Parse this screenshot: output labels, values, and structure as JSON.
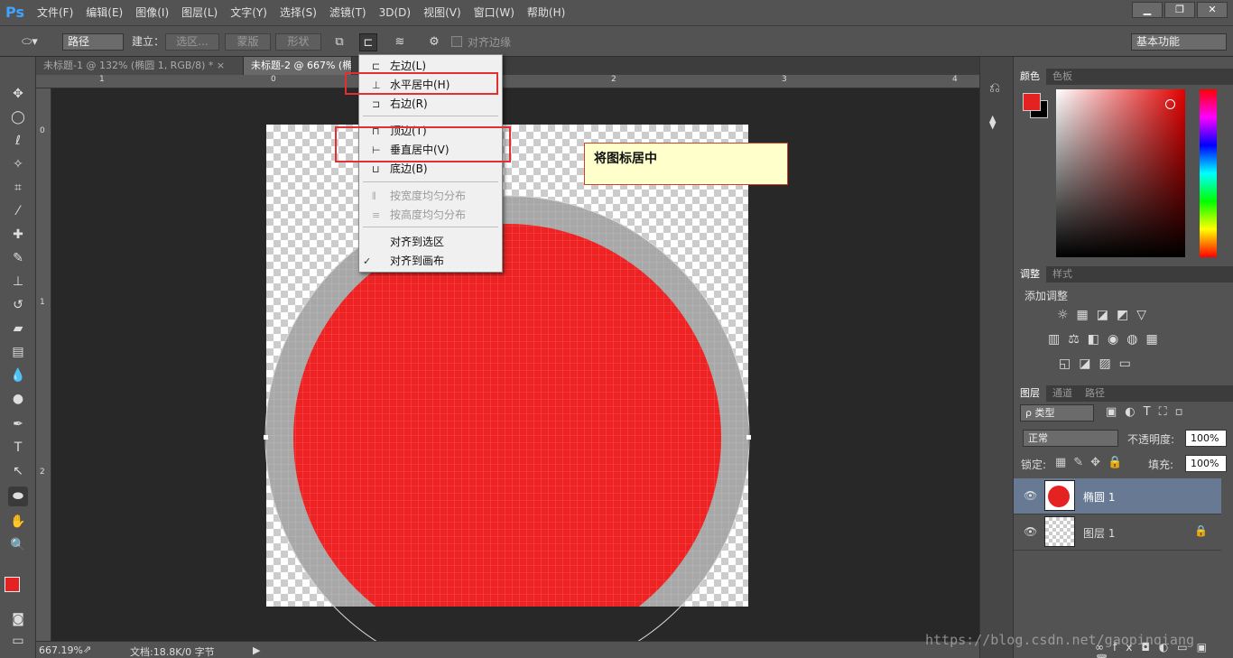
{
  "app": {
    "logo": "Ps"
  },
  "menubar": {
    "items": [
      "文件(F)",
      "编辑(E)",
      "图像(I)",
      "图层(L)",
      "文字(Y)",
      "选择(S)",
      "滤镜(T)",
      "3D(D)",
      "视图(V)",
      "窗口(W)",
      "帮助(H)"
    ]
  },
  "window_controls": {
    "minimize": "▁",
    "restore": "❐",
    "close": "✕"
  },
  "options": {
    "mode_select": "路径",
    "make_label": "建立：",
    "selection_btn": "选区...",
    "mask_btn": "蒙版",
    "shape_btn": "形状",
    "align_edges_label": "对齐边缘",
    "workspace_select": "基本功能"
  },
  "tabs": [
    {
      "label": "未标题-1 @ 132% (椭圆 1, RGB/8) *",
      "close": "×"
    },
    {
      "label": "未标题-2 @ 667% (椭",
      "close": ""
    }
  ],
  "ruler": {
    "h": [
      "1",
      "0",
      "1",
      "2",
      "3",
      "4"
    ],
    "v": [
      "0",
      "1",
      "2"
    ]
  },
  "align_menu": {
    "items": [
      {
        "label": "左边(L)",
        "disabled": false
      },
      {
        "label": "水平居中(H)",
        "disabled": false
      },
      {
        "label": "右边(R)",
        "disabled": false
      },
      {
        "label": "顶边(T)",
        "disabled": false
      },
      {
        "label": "垂直居中(V)",
        "disabled": false
      },
      {
        "label": "底边(B)",
        "disabled": false
      },
      {
        "label": "按宽度均匀分布",
        "disabled": true
      },
      {
        "label": "按高度均匀分布",
        "disabled": true
      },
      {
        "label": "对齐到选区",
        "disabled": false
      },
      {
        "label": "对齐到画布",
        "disabled": false,
        "checked": true
      }
    ],
    "checkmark": "✓"
  },
  "annotation": {
    "text": "将图标居中"
  },
  "statusbar": {
    "zoom": "667.19%",
    "doc_info": "文档:18.8K/0 字节"
  },
  "watermark": "https://blog.csdn.net/gaopinqiang",
  "color_panel": {
    "tabs": [
      "颜色",
      "色板"
    ],
    "foreground": "#e52222",
    "background": "#000000"
  },
  "adjust_panel": {
    "tabs": [
      "调整",
      "样式"
    ],
    "title": "添加调整"
  },
  "layers_panel": {
    "tabs": [
      "图层",
      "通道",
      "路径"
    ],
    "filter": "ρ 类型",
    "blend_mode": "正常",
    "opacity_label": "不透明度:",
    "opacity": "100%",
    "lock_label": "锁定:",
    "fill_label": "填充:",
    "fill": "100%",
    "layers": [
      {
        "name": "椭圆 1",
        "selected": true
      },
      {
        "name": "图层 1",
        "selected": false,
        "locked": true
      }
    ]
  },
  "colors": {
    "accent_red": "#e52222",
    "highlight_box": "#e03030",
    "selected_layer": "#687a93"
  }
}
